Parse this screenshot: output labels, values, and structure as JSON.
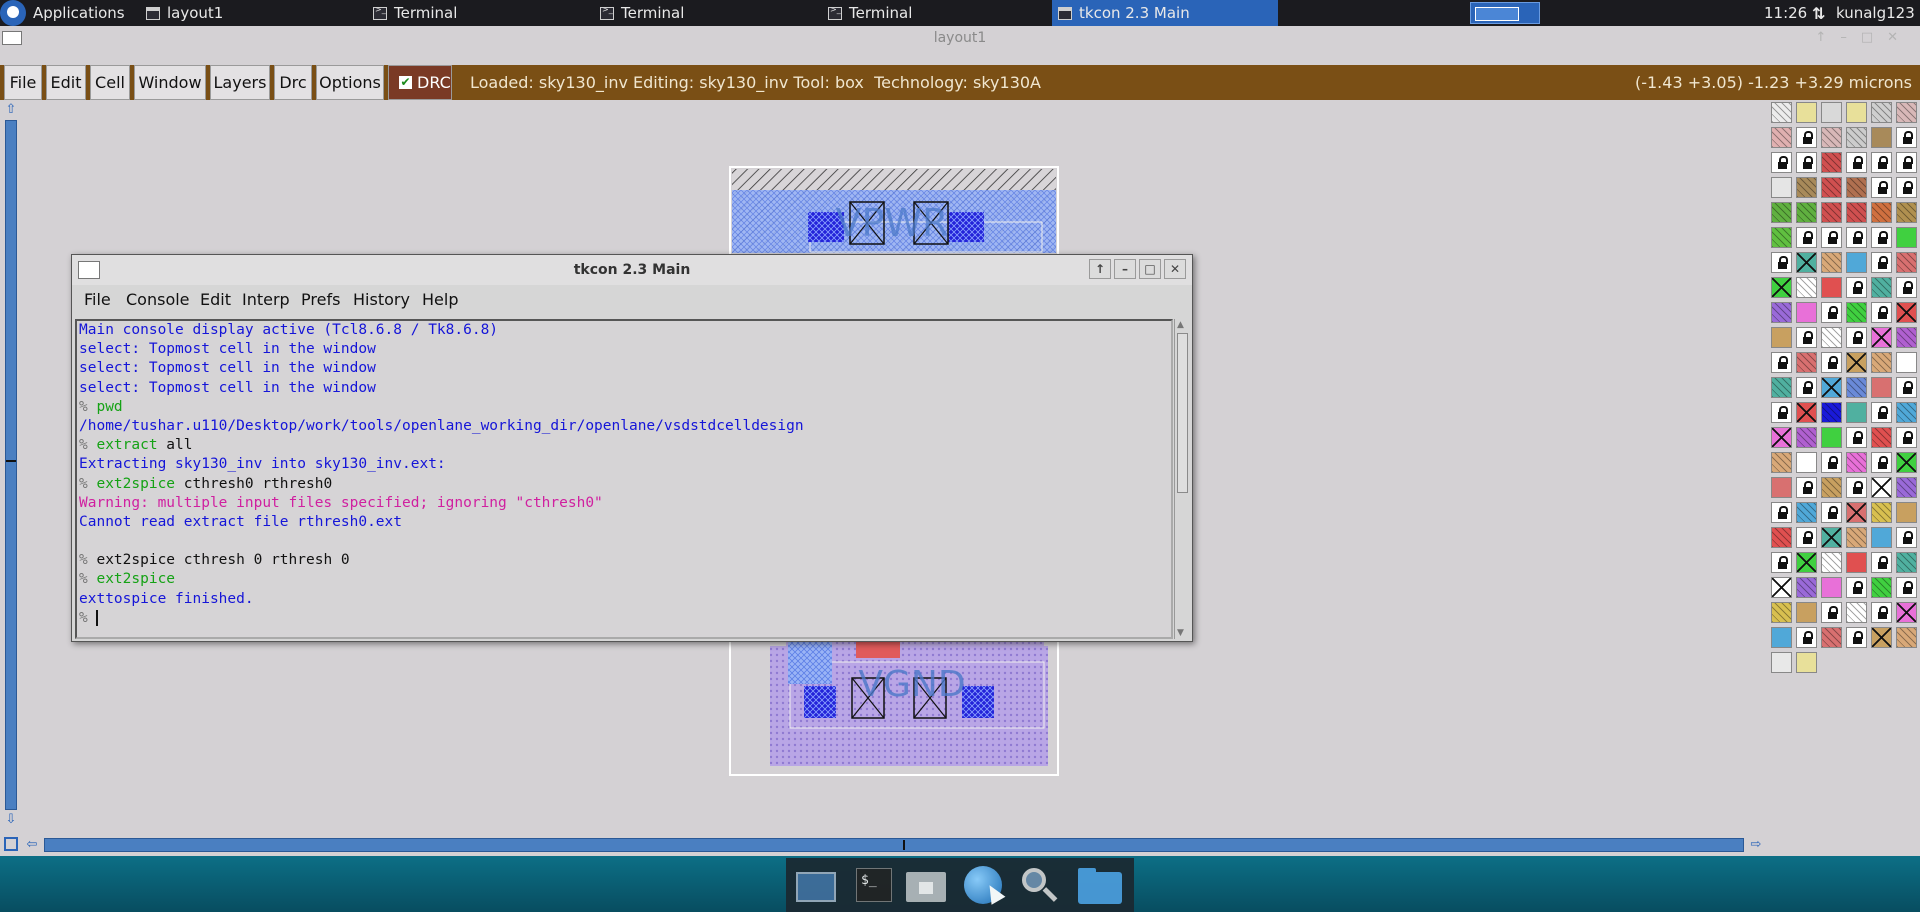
{
  "taskbar": {
    "apps_label": "Applications",
    "items": [
      {
        "label": "layout1",
        "icon": "window-icon"
      },
      {
        "label": "Terminal",
        "icon": "terminal-icon"
      },
      {
        "label": "Terminal",
        "icon": "terminal-icon"
      },
      {
        "label": "Terminal",
        "icon": "terminal-icon"
      },
      {
        "label": "tkcon 2.3 Main",
        "icon": "window-icon",
        "active": true
      }
    ],
    "clock": "11:26",
    "user": "kunalg123"
  },
  "magic": {
    "window_title": "layout1",
    "menu": [
      "File",
      "Edit",
      "Cell",
      "Window",
      "Layers",
      "Drc",
      "Options"
    ],
    "drc_label": "DRC",
    "status": "Loaded: sky130_inv Editing: sky130_inv Tool: box  Technology: sky130A",
    "coords": "(-1.43 +3.05) -1.23 +3.29 microns",
    "layout_labels": {
      "top": "VPWR",
      "bottom": "VGND"
    }
  },
  "tkcon": {
    "title": "tkcon 2.3 Main",
    "menu": [
      "File",
      "Console",
      "Edit",
      "Interp",
      "Prefs",
      "History",
      "Help"
    ],
    "lines": [
      {
        "parts": [
          {
            "t": "Main console display active (Tcl8.6.8 / Tk8.6.8)",
            "c": "blue"
          }
        ]
      },
      {
        "parts": [
          {
            "t": "select: Topmost cell in the window",
            "c": "blue"
          }
        ]
      },
      {
        "parts": [
          {
            "t": "select: Topmost cell in the window",
            "c": "blue"
          }
        ]
      },
      {
        "parts": [
          {
            "t": "select: Topmost cell in the window",
            "c": "blue"
          }
        ]
      },
      {
        "parts": [
          {
            "t": "% ",
            "c": "gray"
          },
          {
            "t": "pwd",
            "c": "green"
          }
        ]
      },
      {
        "parts": [
          {
            "t": "/home/tushar.u110/Desktop/work/tools/openlane_working_dir/openlane/vsdstdcelldesign",
            "c": "blue"
          }
        ]
      },
      {
        "parts": [
          {
            "t": "% ",
            "c": "gray"
          },
          {
            "t": "extract",
            "c": "green"
          },
          {
            "t": " all",
            "c": "black"
          }
        ]
      },
      {
        "parts": [
          {
            "t": "Extracting sky130_inv into sky130_inv.ext:",
            "c": "blue"
          }
        ]
      },
      {
        "parts": [
          {
            "t": "% ",
            "c": "gray"
          },
          {
            "t": "ext2spice",
            "c": "green"
          },
          {
            "t": " cthresh0 rthresh0",
            "c": "black"
          }
        ]
      },
      {
        "parts": [
          {
            "t": "Warning: multiple input files specified; ignoring \"cthresh0\"",
            "c": "magenta"
          }
        ]
      },
      {
        "parts": [
          {
            "t": "Cannot read extract file rthresh0.ext",
            "c": "blue"
          }
        ]
      },
      {
        "parts": [
          {
            "t": "",
            "c": "black"
          }
        ]
      },
      {
        "parts": [
          {
            "t": "% ",
            "c": "gray"
          },
          {
            "t": "ext2spice cthresh 0 rthresh 0",
            "c": "black"
          }
        ]
      },
      {
        "parts": [
          {
            "t": "% ",
            "c": "gray"
          },
          {
            "t": "ext2spice",
            "c": "green"
          }
        ]
      },
      {
        "parts": [
          {
            "t": "exttospice finished.",
            "c": "blue"
          }
        ]
      },
      {
        "parts": [
          {
            "t": "% ",
            "c": "gray"
          }
        ],
        "caret": true
      }
    ]
  },
  "dock": [
    "show-desktop-icon",
    "terminal-icon",
    "home-folder-icon",
    "web-browser-icon",
    "search-icon",
    "files-icon"
  ]
}
